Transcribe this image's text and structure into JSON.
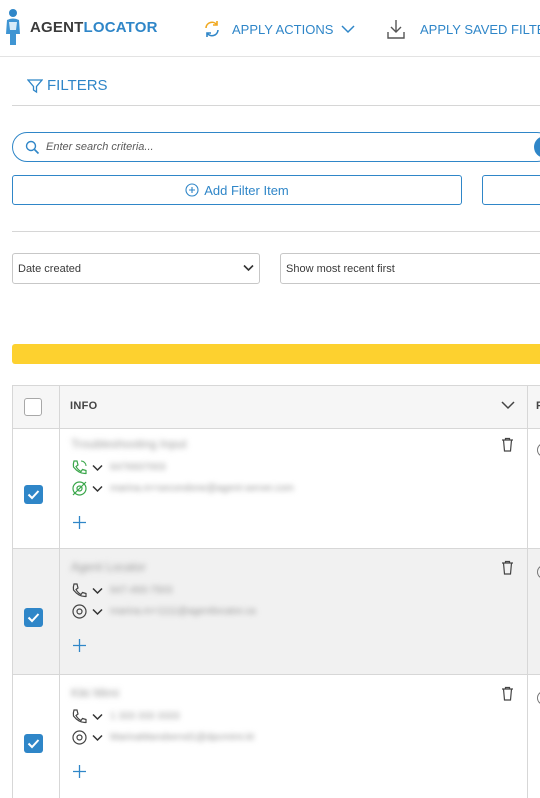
{
  "header": {
    "brand_part1": "AGENT",
    "brand_part2": "LOCATOR",
    "apply_actions_label": "APPLY ACTIONS",
    "apply_saved_filter_label": "APPLY SAVED FILTER"
  },
  "filters": {
    "title": "FILTERS",
    "search_placeholder": "Enter search criteria...",
    "add_filter_label": "Add Filter Item",
    "sort_field": "Date created",
    "sort_order": "Show most recent first"
  },
  "table": {
    "columns": {
      "info": "INFO",
      "next": "P"
    },
    "rows": [
      {
        "name": "Troubleshooting Input",
        "phone": "6476937003",
        "email": "marina.m+secondone@agent-server.com",
        "selected": true,
        "phone_status": "verified",
        "email_status": "unsubscribed"
      },
      {
        "name": "Agent Locator",
        "phone": "647-493-7503",
        "email": "marina.m+1111@agentlocator.ca",
        "selected": true,
        "phone_status": "normal",
        "email_status": "normal"
      },
      {
        "name": "Kiki Mimi",
        "phone": "1 333 333 3333",
        "email": "MarinaMansbernd1@dpcmimi.kt",
        "selected": true,
        "phone_status": "normal",
        "email_status": "normal"
      }
    ]
  },
  "colors": {
    "accent": "#2f86c8",
    "progress": "#fdd12f",
    "status_green": "#3aa64a"
  },
  "icons": [
    "agent-figure-logo-icon",
    "refresh-icon",
    "chevron-down-icon",
    "download-icon",
    "funnel-icon",
    "search-icon",
    "plus-circle-icon",
    "trash-icon",
    "phone-icon",
    "email-at-icon",
    "plus-icon",
    "checkmark-icon"
  ]
}
